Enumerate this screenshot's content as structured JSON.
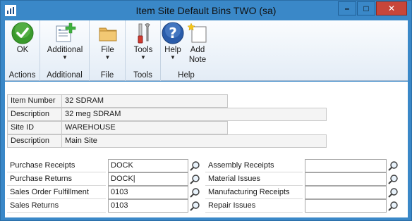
{
  "window": {
    "title": "Item Site Default Bins   TWO (sa)",
    "controls": {
      "minimize": "–",
      "maximize": "□",
      "close": "✕"
    }
  },
  "ribbon": {
    "groups": [
      {
        "label": "Actions",
        "buttons": [
          {
            "label": "OK",
            "icon": "ok-check-icon"
          }
        ]
      },
      {
        "label": "Additional",
        "buttons": [
          {
            "label": "Additional",
            "icon": "additional-icon",
            "has_menu": true
          }
        ]
      },
      {
        "label": "File",
        "buttons": [
          {
            "label": "File",
            "icon": "folder-icon",
            "has_menu": true
          }
        ]
      },
      {
        "label": "Tools",
        "buttons": [
          {
            "label": "Tools",
            "icon": "tools-icon",
            "has_menu": true
          }
        ]
      },
      {
        "label": "Help",
        "buttons": [
          {
            "label": "Help",
            "icon": "help-icon",
            "has_menu": true
          },
          {
            "label": "Add",
            "label2": "Note",
            "icon": "add-note-icon"
          }
        ]
      }
    ]
  },
  "item": {
    "item_number": {
      "label": "Item Number",
      "value": "32 SDRAM"
    },
    "description": {
      "label": "Description",
      "value": "32 meg SDRAM"
    },
    "site_id": {
      "label": "Site ID",
      "value": "WAREHOUSE"
    },
    "site_description": {
      "label": "Description",
      "value": "Main Site"
    }
  },
  "bins_left": [
    {
      "label": "Purchase Receipts",
      "value": "DOCK"
    },
    {
      "label": "Purchase Returns",
      "value": "DOCK|"
    },
    {
      "label": "Sales Order Fulfillment",
      "value": "0103"
    },
    {
      "label": "Sales Returns",
      "value": "0103"
    }
  ],
  "bins_right": [
    {
      "label": "Assembly Receipts",
      "value": ""
    },
    {
      "label": "Material Issues",
      "value": ""
    },
    {
      "label": "Manufacturing Receipts",
      "value": ""
    },
    {
      "label": "Repair Issues",
      "value": ""
    }
  ],
  "colors": {
    "window_frame": "#3a88c8",
    "close_button": "#c7463a",
    "ok_green": "#3a9a2c",
    "help_blue": "#2a5caa"
  }
}
